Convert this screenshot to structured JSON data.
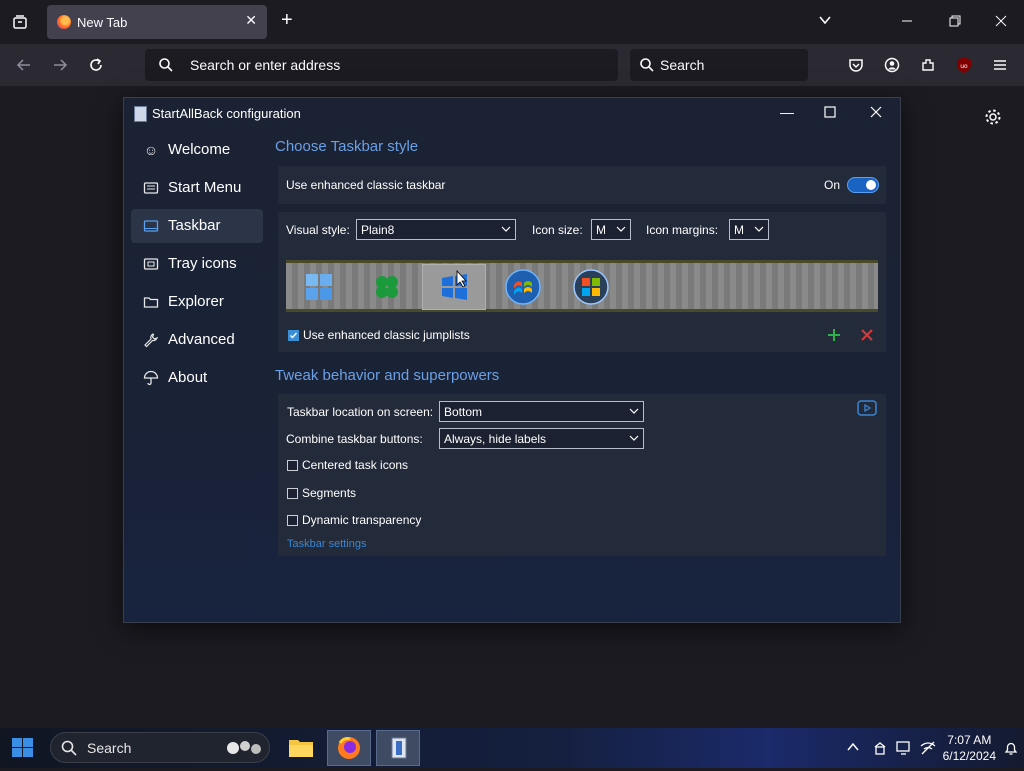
{
  "browser": {
    "tab_title": "New Tab",
    "address_placeholder": "Search or enter address",
    "search_placeholder": "Search"
  },
  "dialog": {
    "title": "StartAllBack configuration",
    "sidebar": [
      {
        "label": "Welcome",
        "icon": "smile-icon"
      },
      {
        "label": "Start Menu",
        "icon": "start-menu-icon"
      },
      {
        "label": "Taskbar",
        "icon": "taskbar-icon"
      },
      {
        "label": "Tray icons",
        "icon": "tray-icon"
      },
      {
        "label": "Explorer",
        "icon": "folder-icon"
      },
      {
        "label": "Advanced",
        "icon": "wrench-icon"
      },
      {
        "label": "About",
        "icon": "umbrella-icon"
      }
    ],
    "section1_title": "Choose Taskbar style",
    "enhanced_taskbar_label": "Use enhanced classic taskbar",
    "toggle_label": "On",
    "visual_style_label": "Visual style:",
    "visual_style_value": "Plain8",
    "icon_size_label": "Icon size:",
    "icon_size_value": "M",
    "icon_margins_label": "Icon margins:",
    "icon_margins_value": "M",
    "jumplists_label": "Use enhanced classic jumplists",
    "section2_title": "Tweak behavior and superpowers",
    "location_label": "Taskbar location on screen:",
    "location_value": "Bottom",
    "combine_label": "Combine taskbar buttons:",
    "combine_value": "Always, hide labels",
    "centered_label": "Centered task icons",
    "segments_label": "Segments",
    "transparency_label": "Dynamic transparency",
    "settings_link": "Taskbar settings"
  },
  "taskbar": {
    "search_label": "Search",
    "time": "7:07 AM",
    "date": "6/12/2024"
  },
  "colors": {
    "accent": "#6aa0e6",
    "toggle_on": "#1a63c3",
    "add_green": "#2bb34a",
    "remove_red": "#d33a3a"
  }
}
